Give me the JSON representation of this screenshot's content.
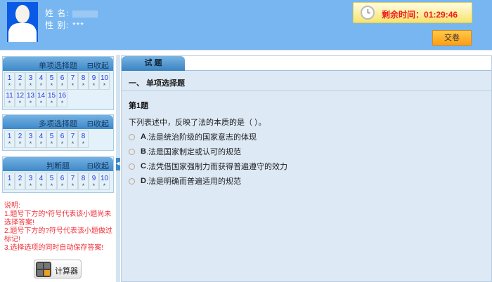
{
  "header": {
    "name_label": "姓 名:",
    "gender_label": "性 别:",
    "gender_value": "***",
    "timer_label": "剩余时间：",
    "timer_value": "01:29:46",
    "submit": "交卷"
  },
  "panels": [
    {
      "title": "单项选择题",
      "collapse": "⊟收起",
      "items": [
        "1",
        "2",
        "3",
        "4",
        "5",
        "6",
        "7",
        "8",
        "9",
        "10",
        "11",
        "12",
        "13",
        "14",
        "15",
        "16"
      ]
    },
    {
      "title": "多项选择题",
      "collapse": "⊟收起",
      "items": [
        "1",
        "2",
        "3",
        "4",
        "5",
        "6",
        "7",
        "8"
      ]
    },
    {
      "title": "判断题",
      "collapse": "⊟收起",
      "items": [
        "1",
        "2",
        "3",
        "4",
        "5",
        "6",
        "7",
        "8",
        "9",
        "10"
      ]
    }
  ],
  "mark": "*",
  "notes": [
    "说明:",
    "1.题号下方的*符号代表该小题尚未选择答案!",
    "2.题号下方的?符号代表该小题做过标记!",
    "3.选择选项的同时自动保存答案!"
  ],
  "calculator": "计算器",
  "main": {
    "tab": "试 题",
    "section": "一、 单项选择题",
    "qnum": "第1题",
    "qtext": "下列表述中，反映了法的本质的是（ ）。",
    "options": [
      {
        "k": "A",
        "t": ".法是统治阶级的国家意志的体现"
      },
      {
        "k": "B",
        "t": ".法是国家制定或认可的规范"
      },
      {
        "k": "C",
        "t": ".法凭借国家强制力而获得普遍遵守的效力"
      },
      {
        "k": "D",
        "t": ".法是明确而普遍适用的规范"
      }
    ]
  }
}
